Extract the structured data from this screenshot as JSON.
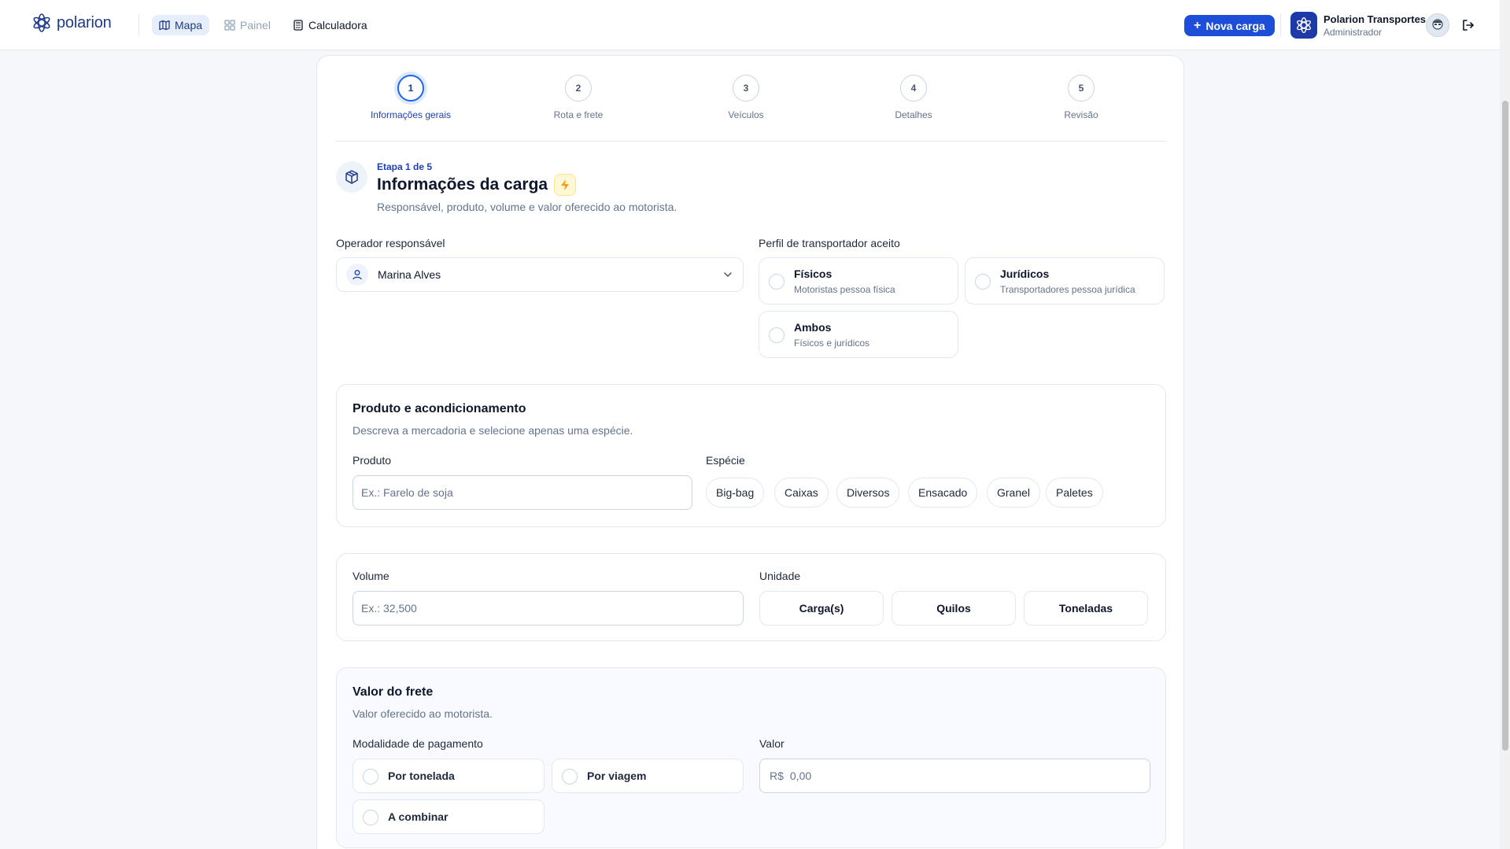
{
  "brand": {
    "name": "polarion",
    "color": "#1e3a8a"
  },
  "nav": {
    "items": [
      {
        "label": "Mapa",
        "icon": "map-icon",
        "state": "active"
      },
      {
        "label": "Painel",
        "icon": "grid-icon",
        "state": "muted"
      },
      {
        "label": "Calculadora",
        "icon": "calculator-icon",
        "state": "normal"
      }
    ]
  },
  "header": {
    "new_button": "Nova carga",
    "company_name": "Polarion Transportes",
    "company_role": "Administrador"
  },
  "stepper": {
    "current": 1,
    "steps": [
      {
        "number": "1",
        "label": "Informações gerais"
      },
      {
        "number": "2",
        "label": "Rota e frete"
      },
      {
        "number": "3",
        "label": "Veículos"
      },
      {
        "number": "4",
        "label": "Detalhes"
      },
      {
        "number": "5",
        "label": "Revisão"
      }
    ]
  },
  "section": {
    "stage": "Etapa 1 de 5",
    "title": "Informações da carga",
    "subtitle": "Responsável, produto, volume e valor oferecido ao motorista."
  },
  "operator": {
    "label": "Operador responsável",
    "value": "Marina Alves"
  },
  "profile": {
    "label": "Perfil de transportador aceito",
    "options": [
      {
        "title": "Físicos",
        "subtitle": "Motoristas pessoa física"
      },
      {
        "title": "Jurídicos",
        "subtitle": "Transportadores pessoa jurídica"
      },
      {
        "title": "Ambos",
        "subtitle": "Físicos e jurídicos"
      }
    ]
  },
  "product": {
    "title": "Produto e acondicionamento",
    "subtitle": "Descreva a mercadoria e selecione apenas uma espécie.",
    "product_label": "Produto",
    "product_placeholder": "Ex.: Farelo de soja",
    "species_label": "Espécie",
    "species": [
      "Big-bag",
      "Caixas",
      "Diversos",
      "Ensacado",
      "Granel",
      "Paletes"
    ]
  },
  "volume": {
    "label": "Volume",
    "placeholder": "Ex.: 32,500",
    "unit_label": "Unidade",
    "units": [
      "Carga(s)",
      "Quilos",
      "Toneladas"
    ]
  },
  "freight": {
    "title": "Valor do frete",
    "subtitle": "Valor oferecido ao motorista.",
    "payment_label": "Modalidade de pagamento",
    "payment_options": [
      "Por tonelada",
      "Por viagem",
      "A combinar"
    ],
    "value_label": "Valor",
    "currency": "R$",
    "value_placeholder": "0,00"
  },
  "colors": {
    "primary": "#1d4ed8",
    "accent_text": "#1e40af",
    "bolt": "#f59e0b"
  }
}
